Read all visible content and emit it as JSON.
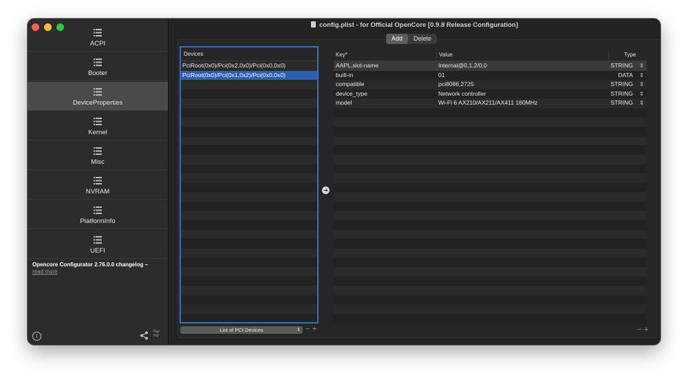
{
  "window": {
    "title": "config.plist - for Official OpenCore [0.9.8 Release Configuration]"
  },
  "sidebar": {
    "items": [
      {
        "label": "ACPI",
        "icon": "list-icon"
      },
      {
        "label": "Booter",
        "icon": "list-icon"
      },
      {
        "label": "DeviceProperties",
        "icon": "list-icon",
        "selected": true
      },
      {
        "label": "Kernel",
        "icon": "list-icon"
      },
      {
        "label": "Misc",
        "icon": "list-icon"
      },
      {
        "label": "NVRAM",
        "icon": "list-icon"
      },
      {
        "label": "PlatformInfo",
        "icon": "list-icon"
      },
      {
        "label": "UEFI",
        "icon": "list-icon"
      }
    ],
    "changelog": {
      "text": "Opencore Configurator 2.76.0.0 changelog –",
      "link": "read more"
    },
    "paypal": {
      "line1": "Pay",
      "line2": "Pal"
    }
  },
  "segmented": {
    "add": "Add",
    "delete": "Delete"
  },
  "devices": {
    "header": "Devices",
    "rows": [
      "PciRoot(0x0)/Pci(0x2,0x0)/Pci(0x0,0x0)",
      "PciRoot(0x0)/Pci(0x1,0x2)/Pci(0x0,0x0)"
    ],
    "selected_index": 1,
    "dropdown_label": "List of PCI Devices"
  },
  "properties": {
    "columns": {
      "key": "Key*",
      "value": "Value",
      "type": "Type"
    },
    "rows": [
      {
        "key": "AAPL,slot-name",
        "value": "Internal@0,1,2/0,0",
        "type": "STRING"
      },
      {
        "key": "built-in",
        "value": "01",
        "type": "DATA"
      },
      {
        "key": "compatible",
        "value": "pci8086,2725",
        "type": "STRING"
      },
      {
        "key": "device_type",
        "value": "Network controller",
        "type": "STRING"
      },
      {
        "key": "model",
        "value": "Wi-Fi 6 AX210/AX211/AX411 160MHz",
        "type": "STRING"
      }
    ]
  },
  "colors": {
    "selection": "#2a5db6",
    "focus_border": "#3b6fb4"
  }
}
